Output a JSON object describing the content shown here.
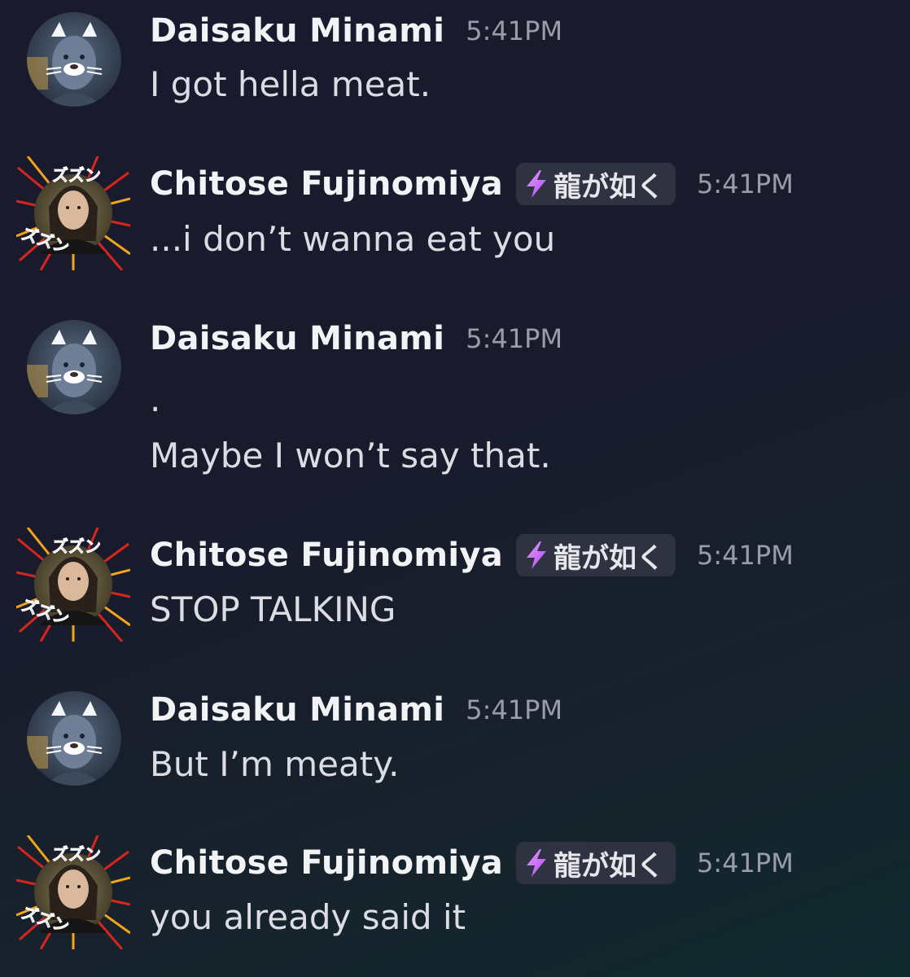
{
  "messages": [
    {
      "author": "Daisaku Minami",
      "time": "5:41PM",
      "lines": [
        "I got hella meat."
      ],
      "avatar": "daisaku-avatar"
    },
    {
      "author": "Chitose Fujinomiya",
      "tag": "龍が如く",
      "tag_icon": "lightning-icon",
      "time": "5:41PM",
      "lines": [
        "...i don’t wanna eat you"
      ],
      "avatar": "chitose-avatar"
    },
    {
      "author": "Daisaku Minami",
      "time": "5:41PM",
      "lines": [
        ".",
        "Maybe I won’t say that."
      ],
      "avatar": "daisaku-avatar"
    },
    {
      "author": "Chitose Fujinomiya",
      "tag": "龍が如く",
      "tag_icon": "lightning-icon",
      "time": "5:41PM",
      "lines": [
        "STOP TALKING"
      ],
      "avatar": "chitose-avatar"
    },
    {
      "author": "Daisaku Minami",
      "time": "5:41PM",
      "lines": [
        "But I’m meaty."
      ],
      "avatar": "daisaku-avatar"
    },
    {
      "author": "Chitose Fujinomiya",
      "tag": "龍が如く",
      "tag_icon": "lightning-icon",
      "time": "5:41PM",
      "lines": [
        "you already said it"
      ],
      "avatar": "chitose-avatar"
    }
  ],
  "avatar_frame_text": "ズズン",
  "colors": {
    "background": "#191b2c",
    "username": "#f2f3f5",
    "message_text": "#dcdde3",
    "timestamp": "#9a9cab",
    "tag_background": "#2f3240",
    "tag_icon": "#c77dff"
  }
}
